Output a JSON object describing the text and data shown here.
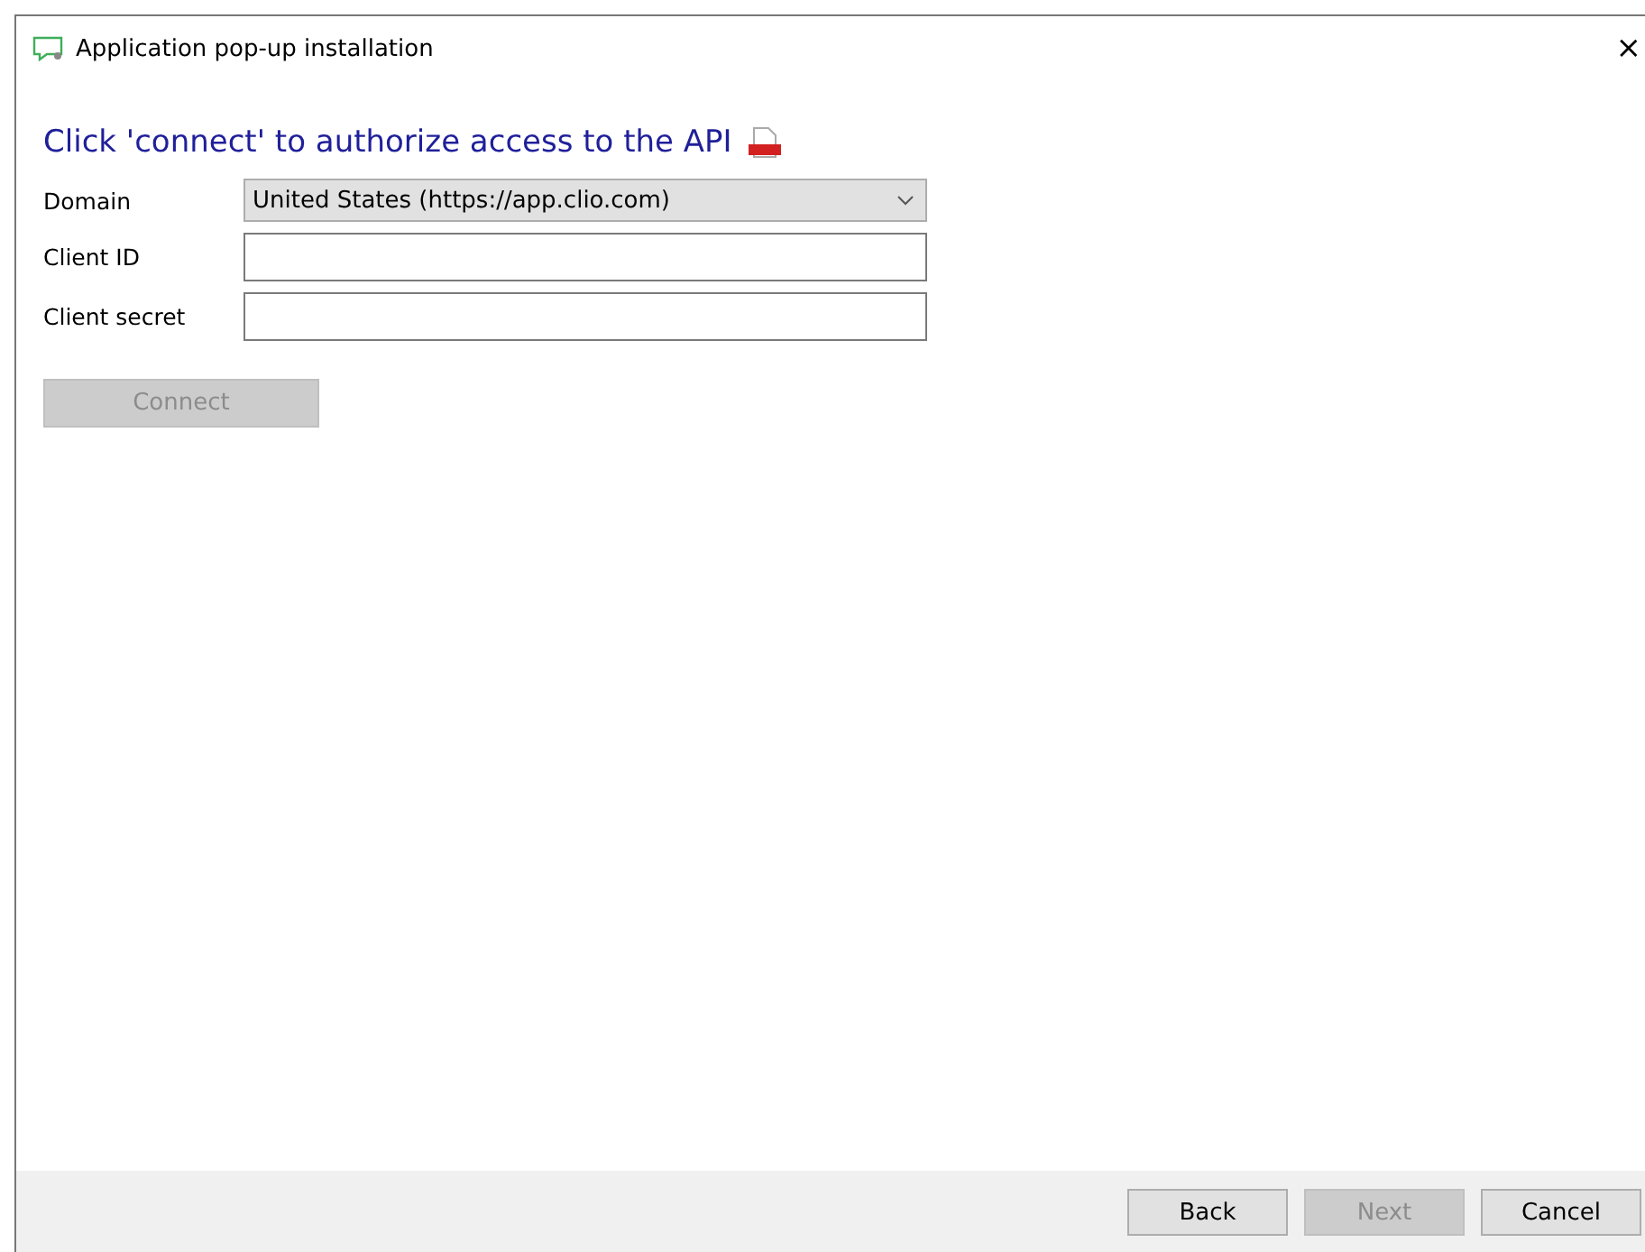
{
  "window": {
    "title": "Application pop-up installation",
    "close": "×"
  },
  "heading": "Click 'connect' to authorize access to the API",
  "fields": [
    {
      "kind": "dropdown",
      "label": "Domain",
      "value": "United States (https://app.clio.com)"
    },
    {
      "kind": "text",
      "label": "Client ID"
    },
    {
      "kind": "text",
      "label": "Client secret"
    }
  ],
  "connect_button": {
    "label": "Connect",
    "disabled": true
  },
  "buttons": [
    {
      "label": "Back",
      "disabled": false
    },
    {
      "label": "Next",
      "disabled": true
    },
    {
      "label": "Cancel",
      "disabled": false
    }
  ]
}
